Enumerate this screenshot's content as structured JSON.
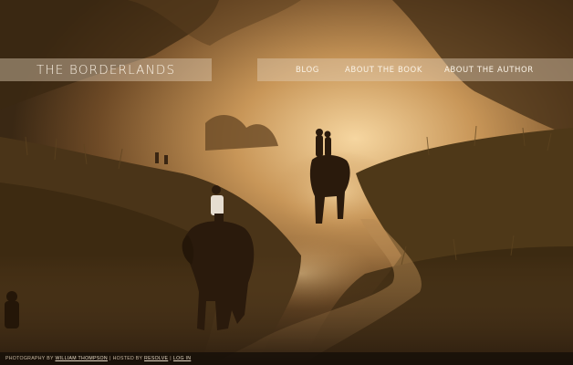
{
  "site": {
    "title": "THE BORDERLANDS"
  },
  "nav": {
    "items": [
      "BLOG",
      "ABOUT THE BOOK",
      "ABOUT THE AUTHOR"
    ]
  },
  "footer": {
    "photo_prefix": "PHOTOGRAPHY BY",
    "photographer": "WILLIAM THOMPSON",
    "separator": "|",
    "hosted_prefix": "HOSTED BY",
    "host": "RESOLVE",
    "login": "LOG IN"
  },
  "photo": {
    "subject": "elephants-on-dusty-path"
  },
  "colors": {
    "bar": "#e1cdb4",
    "text": "#fbf3e6",
    "footer_bg": "#140e08"
  }
}
